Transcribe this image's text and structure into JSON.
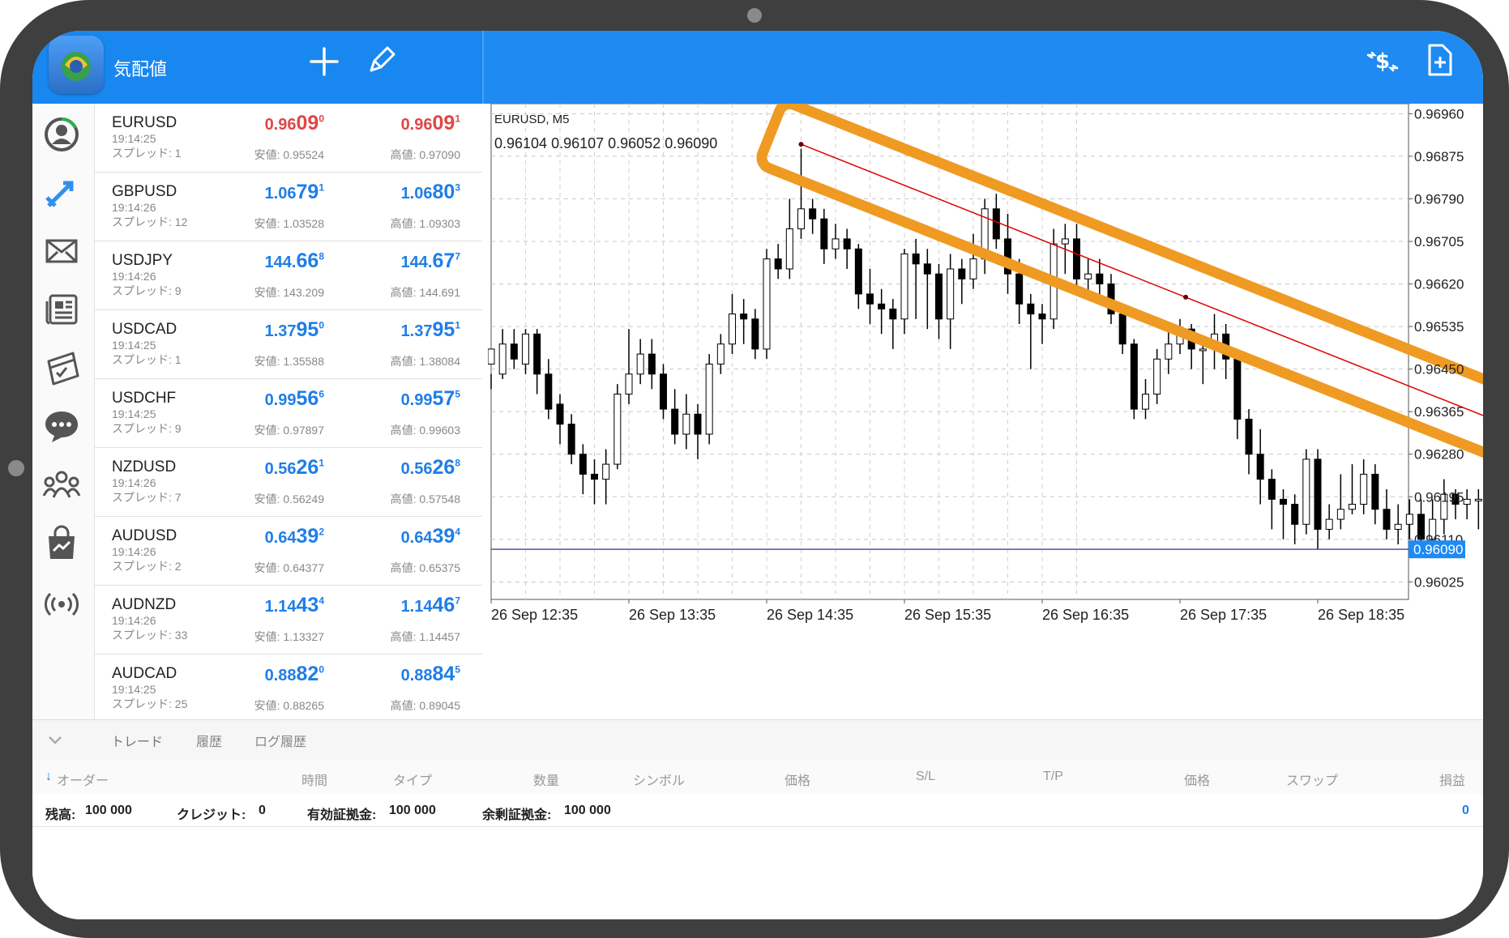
{
  "header": {
    "title": "気配値"
  },
  "quotes": [
    {
      "symbol": "EURUSD",
      "time": "19:14:25",
      "spread": "スプレッド: 1",
      "bid_pre": "0.96",
      "bid_big": "09",
      "bid_sup": "0",
      "ask_pre": "0.96",
      "ask_big": "09",
      "ask_sup": "1",
      "low": "安値: 0.95524",
      "high": "高値: 0.97090",
      "bid_color": "#e04646",
      "ask_color": "#e04646"
    },
    {
      "symbol": "GBPUSD",
      "time": "19:14:26",
      "spread": "スプレッド: 12",
      "bid_pre": "1.06",
      "bid_big": "79",
      "bid_sup": "1",
      "ask_pre": "1.06",
      "ask_big": "80",
      "ask_sup": "3",
      "low": "安値: 1.03528",
      "high": "高値: 1.09303",
      "bid_color": "#1f7ee8",
      "ask_color": "#1f7ee8"
    },
    {
      "symbol": "USDJPY",
      "time": "19:14:26",
      "spread": "スプレッド: 9",
      "bid_pre": "144.",
      "bid_big": "66",
      "bid_sup": "8",
      "ask_pre": "144.",
      "ask_big": "67",
      "ask_sup": "7",
      "low": "安値: 143.209",
      "high": "高値: 144.691",
      "bid_color": "#1f7ee8",
      "ask_color": "#1f7ee8"
    },
    {
      "symbol": "USDCAD",
      "time": "19:14:25",
      "spread": "スプレッド: 1",
      "bid_pre": "1.37",
      "bid_big": "95",
      "bid_sup": "0",
      "ask_pre": "1.37",
      "ask_big": "95",
      "ask_sup": "1",
      "low": "安値: 1.35588",
      "high": "高値: 1.38084",
      "bid_color": "#1f7ee8",
      "ask_color": "#1f7ee8"
    },
    {
      "symbol": "USDCHF",
      "time": "19:14:25",
      "spread": "スプレッド: 9",
      "bid_pre": "0.99",
      "bid_big": "56",
      "bid_sup": "6",
      "ask_pre": "0.99",
      "ask_big": "57",
      "ask_sup": "5",
      "low": "安値: 0.97897",
      "high": "高値: 0.99603",
      "bid_color": "#1f7ee8",
      "ask_color": "#1f7ee8"
    },
    {
      "symbol": "NZDUSD",
      "time": "19:14:26",
      "spread": "スプレッド: 7",
      "bid_pre": "0.56",
      "bid_big": "26",
      "bid_sup": "1",
      "ask_pre": "0.56",
      "ask_big": "26",
      "ask_sup": "8",
      "low": "安値: 0.56249",
      "high": "高値: 0.57548",
      "bid_color": "#1f7ee8",
      "ask_color": "#1f7ee8"
    },
    {
      "symbol": "AUDUSD",
      "time": "19:14:26",
      "spread": "スプレッド: 2",
      "bid_pre": "0.64",
      "bid_big": "39",
      "bid_sup": "2",
      "ask_pre": "0.64",
      "ask_big": "39",
      "ask_sup": "4",
      "low": "安値: 0.64377",
      "high": "高値: 0.65375",
      "bid_color": "#1f7ee8",
      "ask_color": "#1f7ee8"
    },
    {
      "symbol": "AUDNZD",
      "time": "19:14:26",
      "spread": "スプレッド: 33",
      "bid_pre": "1.14",
      "bid_big": "43",
      "bid_sup": "4",
      "ask_pre": "1.14",
      "ask_big": "46",
      "ask_sup": "7",
      "low": "安値: 1.13327",
      "high": "高値: 1.14457",
      "bid_color": "#1f7ee8",
      "ask_color": "#1f7ee8"
    },
    {
      "symbol": "AUDCAD",
      "time": "19:14:25",
      "spread": "スプレッド: 25",
      "bid_pre": "0.88",
      "bid_big": "82",
      "bid_sup": "0",
      "ask_pre": "0.88",
      "ask_big": "84",
      "ask_sup": "5",
      "low": "安値: 0.88265",
      "high": "高値: 0.89045",
      "bid_color": "#1f7ee8",
      "ask_color": "#1f7ee8"
    }
  ],
  "chart_data": {
    "type": "candlestick",
    "symbol_label": "EURUSD, M5",
    "ohlc_label": "0.96104 0.96107 0.96052 0.96090",
    "ylim": [
      0.9599,
      0.9698
    ],
    "y_ticks": [
      "0.96960",
      "0.96875",
      "0.96790",
      "0.96705",
      "0.96620",
      "0.96535",
      "0.96450",
      "0.96365",
      "0.96280",
      "0.96195",
      "0.96110",
      "0.96025"
    ],
    "y_tick_values": [
      0.9696,
      0.96875,
      0.9679,
      0.96705,
      0.9662,
      0.96535,
      0.9645,
      0.96365,
      0.9628,
      0.96195,
      0.9611,
      0.96025
    ],
    "x_ticks": [
      "26 Sep 12:35",
      "26 Sep 13:35",
      "26 Sep 14:35",
      "26 Sep 15:35",
      "26 Sep 16:35",
      "26 Sep 17:35",
      "26 Sep 18:35"
    ],
    "x_tick_index": [
      0,
      12,
      24,
      36,
      48,
      60,
      72
    ],
    "current_price": "0.96090",
    "current_price_value": 0.9609,
    "candles": [
      [
        0.9646,
        0.9649,
        0.9644,
        0.9641
      ],
      [
        0.9644,
        0.965,
        0.9653,
        0.9643
      ],
      [
        0.965,
        0.9647,
        0.9653,
        0.9645
      ],
      [
        0.9646,
        0.9652,
        0.9653,
        0.9644
      ],
      [
        0.9652,
        0.9644,
        0.9653,
        0.964
      ],
      [
        0.9644,
        0.9637,
        0.9647,
        0.9635
      ],
      [
        0.9638,
        0.9634,
        0.964,
        0.963
      ],
      [
        0.9634,
        0.9628,
        0.9636,
        0.9626
      ],
      [
        0.9628,
        0.9624,
        0.963,
        0.962
      ],
      [
        0.9624,
        0.9623,
        0.9627,
        0.9618
      ],
      [
        0.9623,
        0.9626,
        0.9629,
        0.9618
      ],
      [
        0.9626,
        0.964,
        0.9642,
        0.9625
      ],
      [
        0.964,
        0.9644,
        0.9653,
        0.9638
      ],
      [
        0.9644,
        0.9648,
        0.9651,
        0.9642
      ],
      [
        0.9648,
        0.9644,
        0.9651,
        0.9641
      ],
      [
        0.9644,
        0.9637,
        0.9646,
        0.9635
      ],
      [
        0.9637,
        0.9632,
        0.9641,
        0.963
      ],
      [
        0.9632,
        0.9636,
        0.964,
        0.9629
      ],
      [
        0.9636,
        0.9632,
        0.9638,
        0.9627
      ],
      [
        0.9632,
        0.9646,
        0.9648,
        0.963
      ],
      [
        0.9646,
        0.965,
        0.9652,
        0.9644
      ],
      [
        0.965,
        0.9656,
        0.966,
        0.9648
      ],
      [
        0.9656,
        0.9655,
        0.9659,
        0.965
      ],
      [
        0.9655,
        0.9649,
        0.9657,
        0.9647
      ],
      [
        0.9649,
        0.9667,
        0.9669,
        0.9647
      ],
      [
        0.9667,
        0.9665,
        0.967,
        0.9663
      ],
      [
        0.9665,
        0.9673,
        0.9679,
        0.9663
      ],
      [
        0.9673,
        0.9677,
        0.9689,
        0.9671
      ],
      [
        0.9677,
        0.9675,
        0.9679,
        0.9672
      ],
      [
        0.9675,
        0.9669,
        0.9677,
        0.9666
      ],
      [
        0.9669,
        0.9671,
        0.9674,
        0.9667
      ],
      [
        0.9671,
        0.9669,
        0.9673,
        0.9665
      ],
      [
        0.9669,
        0.966,
        0.967,
        0.9657
      ],
      [
        0.966,
        0.9658,
        0.9665,
        0.9654
      ],
      [
        0.9658,
        0.9657,
        0.9661,
        0.9652
      ],
      [
        0.9657,
        0.9655,
        0.9659,
        0.9649
      ],
      [
        0.9655,
        0.9668,
        0.9669,
        0.9652
      ],
      [
        0.9668,
        0.9666,
        0.9671,
        0.9655
      ],
      [
        0.9666,
        0.9664,
        0.9669,
        0.9653
      ],
      [
        0.9664,
        0.9655,
        0.9666,
        0.9651
      ],
      [
        0.9655,
        0.9665,
        0.9668,
        0.9649
      ],
      [
        0.9665,
        0.9663,
        0.9667,
        0.9658
      ],
      [
        0.9663,
        0.9667,
        0.9672,
        0.9661
      ],
      [
        0.9667,
        0.9677,
        0.9679,
        0.9664
      ],
      [
        0.9677,
        0.9671,
        0.968,
        0.9669
      ],
      [
        0.9671,
        0.9664,
        0.9676,
        0.966
      ],
      [
        0.9664,
        0.9658,
        0.9667,
        0.9654
      ],
      [
        0.9658,
        0.9656,
        0.966,
        0.9645
      ],
      [
        0.9656,
        0.9655,
        0.9658,
        0.965
      ],
      [
        0.9655,
        0.967,
        0.9673,
        0.9653
      ],
      [
        0.967,
        0.9671,
        0.9674,
        0.9664
      ],
      [
        0.9671,
        0.9663,
        0.9674,
        0.966
      ],
      [
        0.9663,
        0.9664,
        0.9667,
        0.9659
      ],
      [
        0.9664,
        0.9662,
        0.9667,
        0.9658
      ],
      [
        0.9662,
        0.9656,
        0.9664,
        0.9654
      ],
      [
        0.9656,
        0.965,
        0.9658,
        0.9648
      ],
      [
        0.965,
        0.9637,
        0.9651,
        0.9635
      ],
      [
        0.9637,
        0.964,
        0.9643,
        0.9635
      ],
      [
        0.964,
        0.9647,
        0.9649,
        0.9638
      ],
      [
        0.9647,
        0.965,
        0.9654,
        0.9644
      ],
      [
        0.965,
        0.9653,
        0.9655,
        0.9648
      ],
      [
        0.9653,
        0.9649,
        0.9654,
        0.9645
      ],
      [
        0.9649,
        0.9649,
        0.9651,
        0.9642
      ],
      [
        0.9649,
        0.9652,
        0.9656,
        0.9645
      ],
      [
        0.9652,
        0.9647,
        0.9654,
        0.9643
      ],
      [
        0.9647,
        0.9635,
        0.9649,
        0.9631
      ],
      [
        0.9635,
        0.9628,
        0.9637,
        0.9624
      ],
      [
        0.9628,
        0.9623,
        0.9633,
        0.9618
      ],
      [
        0.9623,
        0.9619,
        0.9625,
        0.9613
      ],
      [
        0.9619,
        0.9618,
        0.9621,
        0.9611
      ],
      [
        0.9618,
        0.9614,
        0.962,
        0.961
      ],
      [
        0.9614,
        0.9627,
        0.9629,
        0.9612
      ],
      [
        0.9627,
        0.9613,
        0.9629,
        0.9609
      ],
      [
        0.9613,
        0.9615,
        0.9618,
        0.9611
      ],
      [
        0.9615,
        0.9617,
        0.9624,
        0.9613
      ],
      [
        0.9617,
        0.9618,
        0.9626,
        0.9616
      ],
      [
        0.9618,
        0.9624,
        0.9627,
        0.9616
      ],
      [
        0.9624,
        0.9617,
        0.9626,
        0.9614
      ],
      [
        0.9617,
        0.9613,
        0.9621,
        0.9611
      ],
      [
        0.9613,
        0.9614,
        0.9618,
        0.961
      ],
      [
        0.9614,
        0.9616,
        0.9619,
        0.9611
      ],
      [
        0.9616,
        0.9611,
        0.9619,
        0.9609
      ],
      [
        0.9611,
        0.9615,
        0.9619,
        0.961
      ],
      [
        0.9615,
        0.962,
        0.9623,
        0.9612
      ],
      [
        0.962,
        0.9618,
        0.9621,
        0.9615
      ],
      [
        0.9618,
        0.9619,
        0.9621,
        0.9615
      ],
      [
        0.9619,
        0.9619,
        0.9621,
        0.9613
      ],
      [
        0.9619,
        0.961,
        0.9621,
        0.9606
      ],
      [
        0.961,
        0.9609,
        0.9611,
        0.9605
      ]
    ],
    "trendline": {
      "from": {
        "index": 27,
        "price": 0.96899
      },
      "to": {
        "index": 94,
        "price": 0.96288
      },
      "color": "#e00000"
    },
    "highlight_color": "#ef9a22"
  },
  "bottom": {
    "tabs": [
      "トレード",
      "履歴",
      "ログ履歴"
    ],
    "columns": [
      "オーダー",
      "時間",
      "タイプ",
      "数量",
      "シンボル",
      "価格",
      "S/L",
      "T/P",
      "価格",
      "スワップ",
      "損益"
    ],
    "balance": [
      {
        "label": "残高:",
        "value": "100 000"
      },
      {
        "label": "クレジット:",
        "value": "0"
      },
      {
        "label": "有効証拠金:",
        "value": "100 000"
      },
      {
        "label": "余剰証拠金:",
        "value": "100 000"
      }
    ],
    "profit": "0"
  },
  "icons": {
    "add": "plus-icon",
    "edit": "pencil-icon",
    "price": "dollar-arrows-icon",
    "new": "new-document-icon",
    "nav": [
      "account-icon",
      "trade-arrows-icon",
      "mail-icon",
      "news-icon",
      "calendar-icon",
      "chat-icon",
      "community-icon",
      "market-icon",
      "signal-icon"
    ]
  },
  "colors": {
    "topbar": "#1987f0",
    "bid_red": "#e04646",
    "quote_blue": "#1f7ee8",
    "trendline": "#e00000",
    "highlight": "#ef9a22"
  }
}
